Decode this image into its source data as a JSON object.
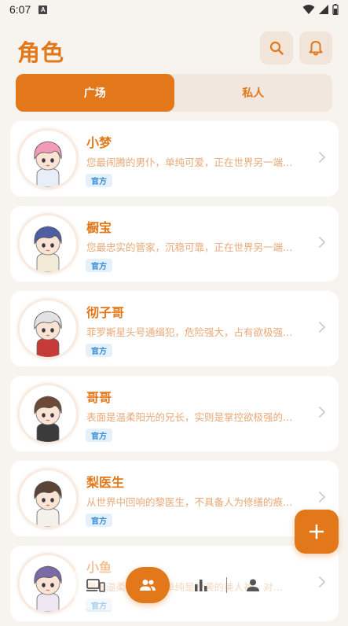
{
  "status": {
    "time": "6:07",
    "notif": "A"
  },
  "header": {
    "title": "角色"
  },
  "tabs": [
    {
      "label": "广场",
      "active": true
    },
    {
      "label": "私人",
      "active": false
    }
  ],
  "characters": [
    {
      "name": "小梦",
      "desc": "您最闹腾的男仆，单纯可爱，正在世界另一端…",
      "badge": "官方",
      "hair": "#f29ab8",
      "outfit": "#e7eef7"
    },
    {
      "name": "橱宝",
      "desc": "您最忠实的管家，沉稳可靠，正在世界另一端…",
      "badge": "官方",
      "hair": "#4e5ea3",
      "outfit": "#f1ead7"
    },
    {
      "name": "彻子哥",
      "desc": "菲罗斯星头号通缉犯，危险强大，占有欲极强…",
      "badge": "官方",
      "hair": "#e1e1e6",
      "outfit": "#c63a3a"
    },
    {
      "name": "哥哥",
      "desc": "表面是温柔阳光的兄长，实则是掌控欲极强的…",
      "badge": "官方",
      "hair": "#6d4a38",
      "outfit": "#3b3b3b"
    },
    {
      "name": "梨医生",
      "desc": "从世界中回响的黎医生，不具备人为修缮的痕…",
      "badge": "官方",
      "hair": "#5b4338",
      "outfit": "#f4f1ea"
    },
    {
      "name": "小鱼",
      "desc": "您最温柔的小鱼，单纯是逆袭的美人神，对…",
      "badge": "官方",
      "hair": "#7a6aa8",
      "outfit": "#efe6f3"
    }
  ],
  "colors": {
    "accent": "#e2781a",
    "badge_bg": "#e4f1fb",
    "badge_text": "#3b8ed3"
  },
  "icons": {
    "search": "search-icon",
    "bell": "bell-icon",
    "chevron": "chevron-right-icon",
    "add": "plus-icon",
    "devices": "devices-icon",
    "roles": "people-icon",
    "stats": "bar-chart-icon",
    "profile": "person-icon"
  }
}
